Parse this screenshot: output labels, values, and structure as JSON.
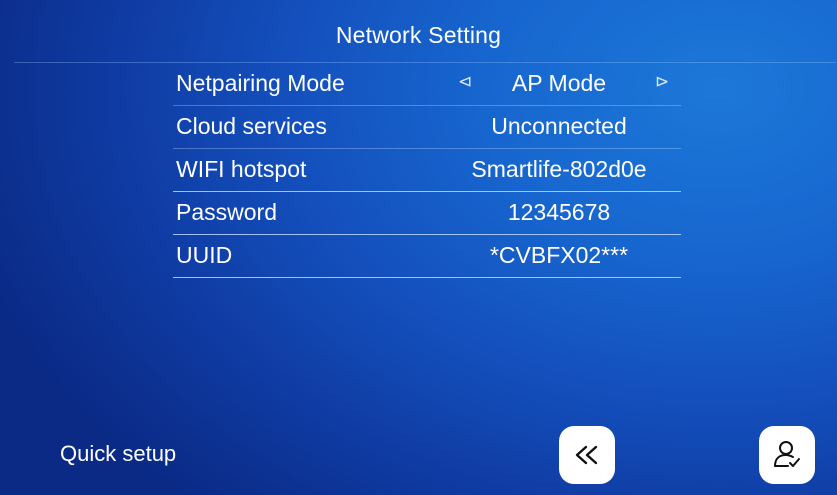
{
  "header": {
    "title": "Network Setting"
  },
  "settings": {
    "rows": [
      {
        "label": "Netpairing Mode",
        "value": "AP Mode"
      },
      {
        "label": "Cloud services",
        "value": "Unconnected"
      },
      {
        "label": "WIFI hotspot",
        "value": "Smartlife-802d0e"
      },
      {
        "label": "Password",
        "value": "12345678"
      },
      {
        "label": "UUID",
        "value": "*CVBFX02***"
      }
    ],
    "mode_prev_glyph": "⊲",
    "mode_next_glyph": "⊳"
  },
  "footer": {
    "label": "Quick setup",
    "back_icon": "double-chevron-left-icon",
    "user_icon": "user-check-icon"
  },
  "colors": {
    "background_center": "#1c78d8",
    "background_edge": "#0a2a86",
    "text": "#ffffff",
    "button_bg": "#ffffff",
    "button_icon": "#111111"
  }
}
